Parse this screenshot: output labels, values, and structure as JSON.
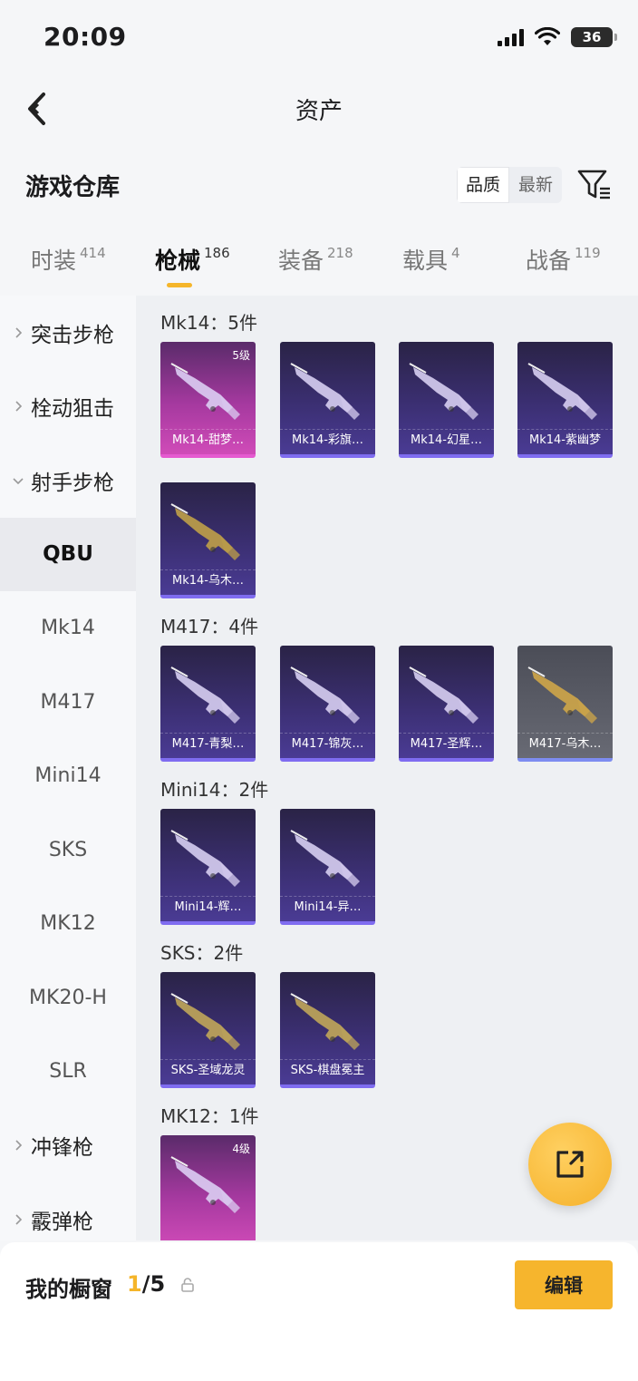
{
  "status": {
    "time": "20:09",
    "battery": "36"
  },
  "nav": {
    "title": "资产"
  },
  "header": {
    "title": "游戏仓库",
    "sort_options": [
      "品质",
      "最新"
    ],
    "sort_active": 0
  },
  "tabs": [
    {
      "label": "时装",
      "count": "414"
    },
    {
      "label": "枪械",
      "count": "186"
    },
    {
      "label": "装备",
      "count": "218"
    },
    {
      "label": "载具",
      "count": "4"
    },
    {
      "label": "战备",
      "count": "119"
    }
  ],
  "active_tab": 1,
  "sidebar": {
    "groups": [
      {
        "label": "突击步枪",
        "expanded": false
      },
      {
        "label": "栓动狙击",
        "expanded": false
      },
      {
        "label": "射手步枪",
        "expanded": true
      },
      {
        "label": "冲锋枪",
        "expanded": false
      },
      {
        "label": "霰弹枪",
        "expanded": false
      }
    ],
    "subitems": [
      "QBU",
      "Mk14",
      "M417",
      "Mini14",
      "SKS",
      "MK12",
      "MK20-H",
      "SLR"
    ],
    "active_subitem": "QBU"
  },
  "content": {
    "groups": [
      {
        "title": "Mk14：5件",
        "items": [
          {
            "name": "Mk14-甜梦…",
            "rarity": "pink",
            "level": "5级"
          },
          {
            "name": "Mk14-彩旗…",
            "rarity": "purple"
          },
          {
            "name": "Mk14-幻星…",
            "rarity": "purple"
          },
          {
            "name": "Mk14-紫幽梦",
            "rarity": "purple"
          },
          {
            "name": "Mk14-乌木…",
            "rarity": "purple"
          }
        ]
      },
      {
        "title": "M417：4件",
        "items": [
          {
            "name": "M417-青梨…",
            "rarity": "purple"
          },
          {
            "name": "M417-锦灰…",
            "rarity": "purple"
          },
          {
            "name": "M417-圣辉…",
            "rarity": "purple"
          },
          {
            "name": "M417-乌木…",
            "rarity": "gray"
          }
        ]
      },
      {
        "title": "Mini14：2件",
        "items": [
          {
            "name": "Mini14-辉…",
            "rarity": "purple"
          },
          {
            "name": "Mini14-异…",
            "rarity": "purple"
          }
        ]
      },
      {
        "title": "SKS：2件",
        "items": [
          {
            "name": "SKS-圣域龙灵",
            "rarity": "purple"
          },
          {
            "name": "SKS-棋盘冕主",
            "rarity": "purple"
          }
        ]
      },
      {
        "title": "MK12：1件",
        "items": [
          {
            "name": "",
            "rarity": "pink",
            "level": "4级"
          }
        ]
      }
    ]
  },
  "bottom": {
    "title": "我的橱窗",
    "current": "1",
    "total": "/5",
    "edit_label": "编辑"
  }
}
